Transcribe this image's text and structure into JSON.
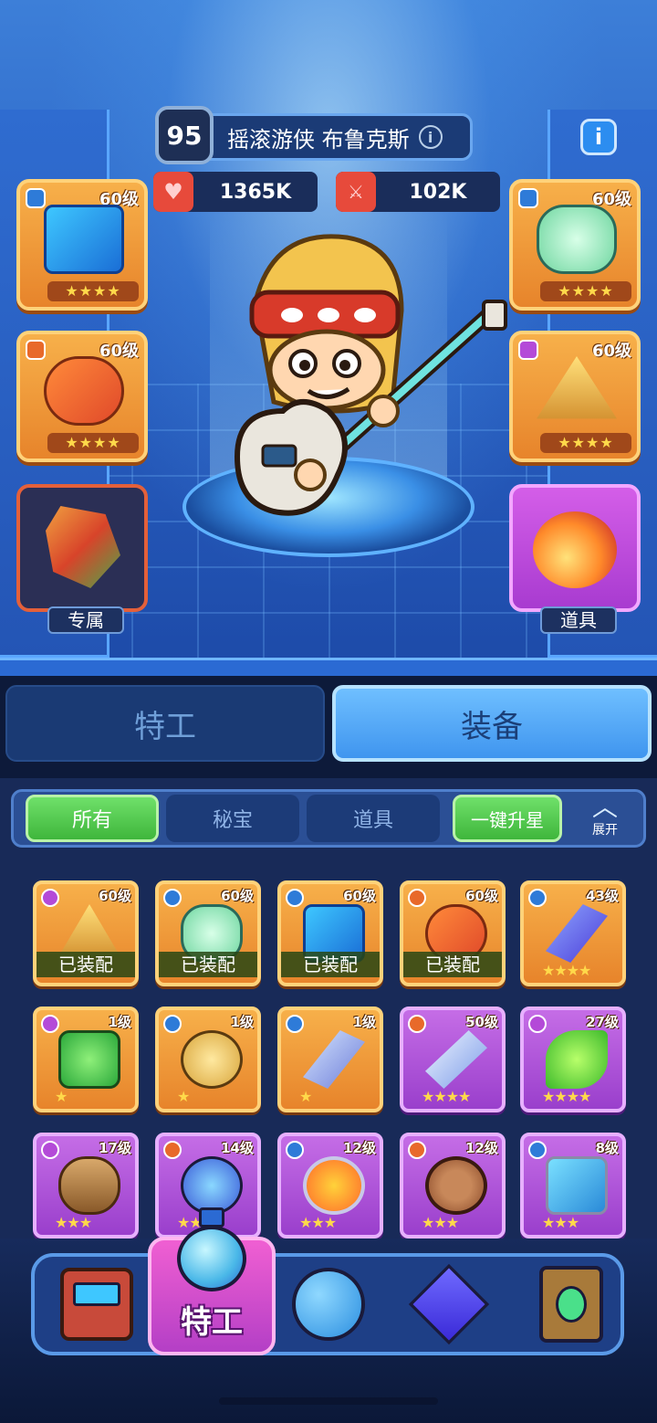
{
  "hero": {
    "level": "95",
    "name": "摇滚游侠 布鲁克斯",
    "info_icon": "i",
    "hp": "1365K",
    "atk": "102K"
  },
  "slots": {
    "left_top": {
      "level": "60级",
      "stars": "★★★★",
      "rarity": "shield"
    },
    "left_mid": {
      "level": "60级",
      "stars": "★★★★",
      "rarity": "crown"
    },
    "right_top": {
      "level": "60级",
      "stars": "★★★★",
      "rarity": "shield"
    },
    "right_mid": {
      "level": "60级",
      "stars": "★★★★",
      "rarity": "circle"
    },
    "exclusive_label": "专属",
    "prop_label": "道具"
  },
  "tabs": {
    "agent": "特工",
    "equipment": "装备"
  },
  "filters": {
    "all": "所有",
    "treasure": "秘宝",
    "props": "道具",
    "upstar": "一键升星",
    "expand": "展开"
  },
  "equipped_label": "已装配",
  "items": [
    {
      "level": "60级",
      "stars": "",
      "equipped": true,
      "rarity": "circle"
    },
    {
      "level": "60级",
      "stars": "",
      "equipped": true,
      "rarity": "shield"
    },
    {
      "level": "60级",
      "stars": "",
      "equipped": true,
      "rarity": "shield"
    },
    {
      "level": "60级",
      "stars": "",
      "equipped": true,
      "rarity": "crown"
    },
    {
      "level": "43级",
      "stars": "★★★★",
      "equipped": false,
      "rarity": "shield"
    },
    {
      "level": "1级",
      "stars": "★",
      "equipped": false,
      "rarity": "circle"
    },
    {
      "level": "1级",
      "stars": "★",
      "equipped": false,
      "rarity": "shield"
    },
    {
      "level": "1级",
      "stars": "★",
      "equipped": false,
      "rarity": "shield"
    },
    {
      "level": "50级",
      "stars": "★★★★",
      "equipped": false,
      "rarity": "crown"
    },
    {
      "level": "27级",
      "stars": "★★★★",
      "equipped": false,
      "rarity": "circle"
    },
    {
      "level": "17级",
      "stars": "★★★",
      "equipped": false,
      "rarity": "circle"
    },
    {
      "level": "14级",
      "stars": "★★★",
      "equipped": false,
      "rarity": "crown"
    },
    {
      "level": "12级",
      "stars": "★★★",
      "equipped": false,
      "rarity": "shield"
    },
    {
      "level": "12级",
      "stars": "★★★",
      "equipped": false,
      "rarity": "crown"
    },
    {
      "level": "8级",
      "stars": "★★★",
      "equipped": false,
      "rarity": "shield"
    }
  ],
  "nav": {
    "active_label": "特工"
  },
  "colors": {
    "gold_card": "#f0a040",
    "purple_card": "#b055dd",
    "accent_green": "#4fc84a",
    "accent_blue": "#3f95ef"
  }
}
